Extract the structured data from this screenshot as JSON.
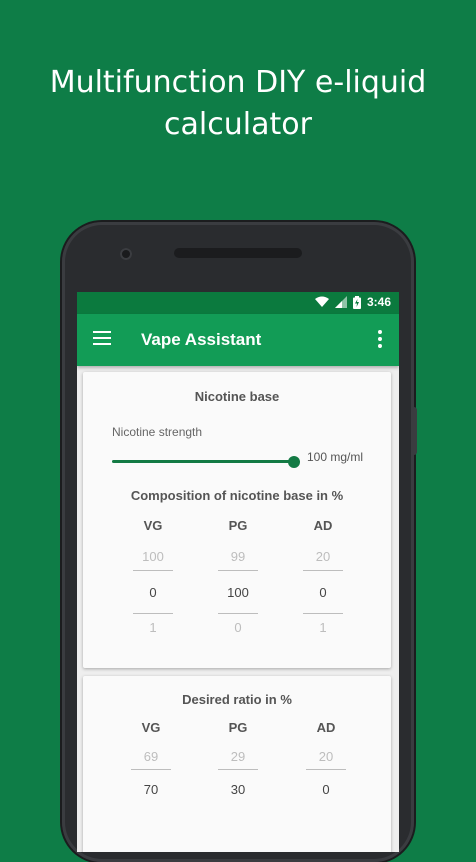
{
  "headline": {
    "line1": "Multifunction DIY e-liquid",
    "line2": "calculator"
  },
  "status_bar": {
    "time": "3:46"
  },
  "app_bar": {
    "title": "Vape Assistant"
  },
  "nicotine_base_card": {
    "title": "Nicotine base",
    "strength_label": "Nicotine strength",
    "strength_value": "100 mg/ml",
    "slider_level": 1.0,
    "composition_title": "Composition of nicotine base in %",
    "columns": [
      {
        "head": "VG",
        "prev": "100",
        "current": "0",
        "next": "1"
      },
      {
        "head": "PG",
        "prev": "99",
        "current": "100",
        "next": "0"
      },
      {
        "head": "AD",
        "prev": "20",
        "current": "0",
        "next": "1"
      }
    ]
  },
  "ratio_card": {
    "title": "Desired ratio in %",
    "columns": [
      {
        "head": "VG",
        "prev": "69",
        "current": "70"
      },
      {
        "head": "PG",
        "prev": "29",
        "current": "30"
      },
      {
        "head": "AD",
        "prev": "20",
        "current": "0"
      }
    ]
  },
  "colors": {
    "background": "#0e7d47",
    "app_bar": "#129c56",
    "status_bar": "#0b7a3e",
    "accent": "#137a44"
  }
}
